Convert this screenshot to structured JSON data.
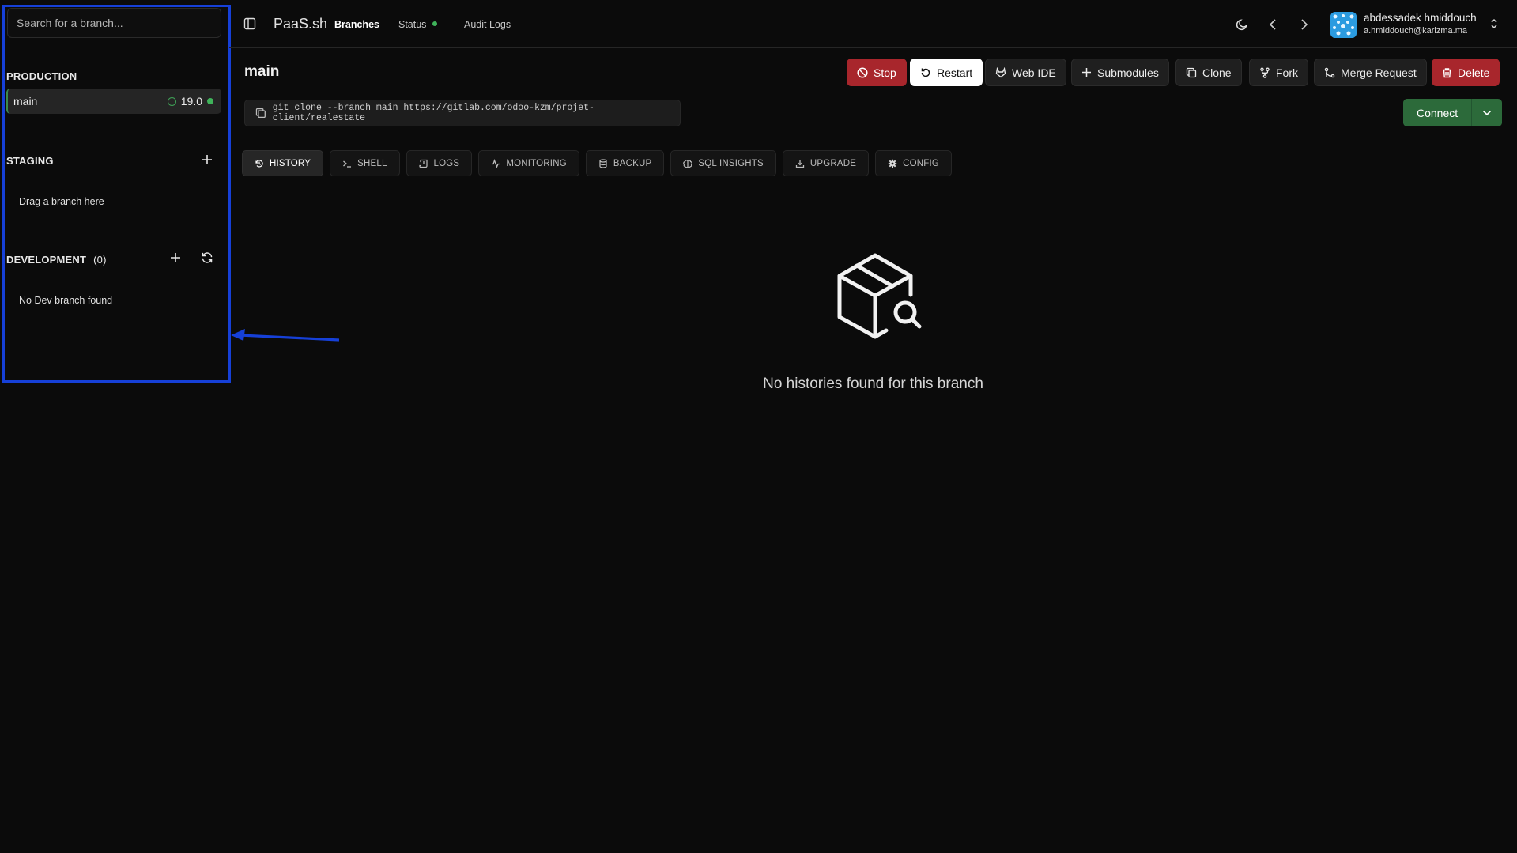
{
  "sidebar": {
    "search": {
      "placeholder": "Search for a branch..."
    },
    "production": {
      "title": "PRODUCTION",
      "branch": {
        "name": "main",
        "version": "19.0"
      }
    },
    "staging": {
      "title": "STAGING",
      "empty": "Drag a branch here"
    },
    "development": {
      "title": "DEVELOPMENT",
      "count": "(0)",
      "empty": "No Dev branch found"
    }
  },
  "topbar": {
    "brand": "PaaS.sh",
    "nav": {
      "branches": "Branches",
      "status": "Status",
      "audit_logs": "Audit Logs"
    },
    "user": {
      "name": "abdessadek hmiddouch",
      "email": "a.hmiddouch@karizma.ma"
    }
  },
  "main": {
    "title": "main",
    "actions": {
      "stop": "Stop",
      "restart": "Restart",
      "web_ide": "Web IDE",
      "submodules": "Submodules",
      "clone": "Clone",
      "fork": "Fork",
      "merge_request": "Merge Request",
      "delete": "Delete"
    },
    "clone_command": "git clone --branch main https://gitlab.com/odoo-kzm/projet-client/realestate",
    "connect": "Connect",
    "tabs": {
      "history": "HISTORY",
      "shell": "SHELL",
      "logs": "LOGS",
      "monitoring": "MONITORING",
      "backup": "BACKUP",
      "sql_insights": "SQL INSIGHTS",
      "upgrade": "UPGRADE",
      "config": "CONFIG"
    },
    "empty_message": "No histories found for this branch"
  },
  "colors": {
    "background": "#0b0b0b",
    "danger": "#a8262c",
    "success": "#2c6a3a",
    "status_green": "#3fb35a",
    "annotation_blue": "#1640d8"
  }
}
